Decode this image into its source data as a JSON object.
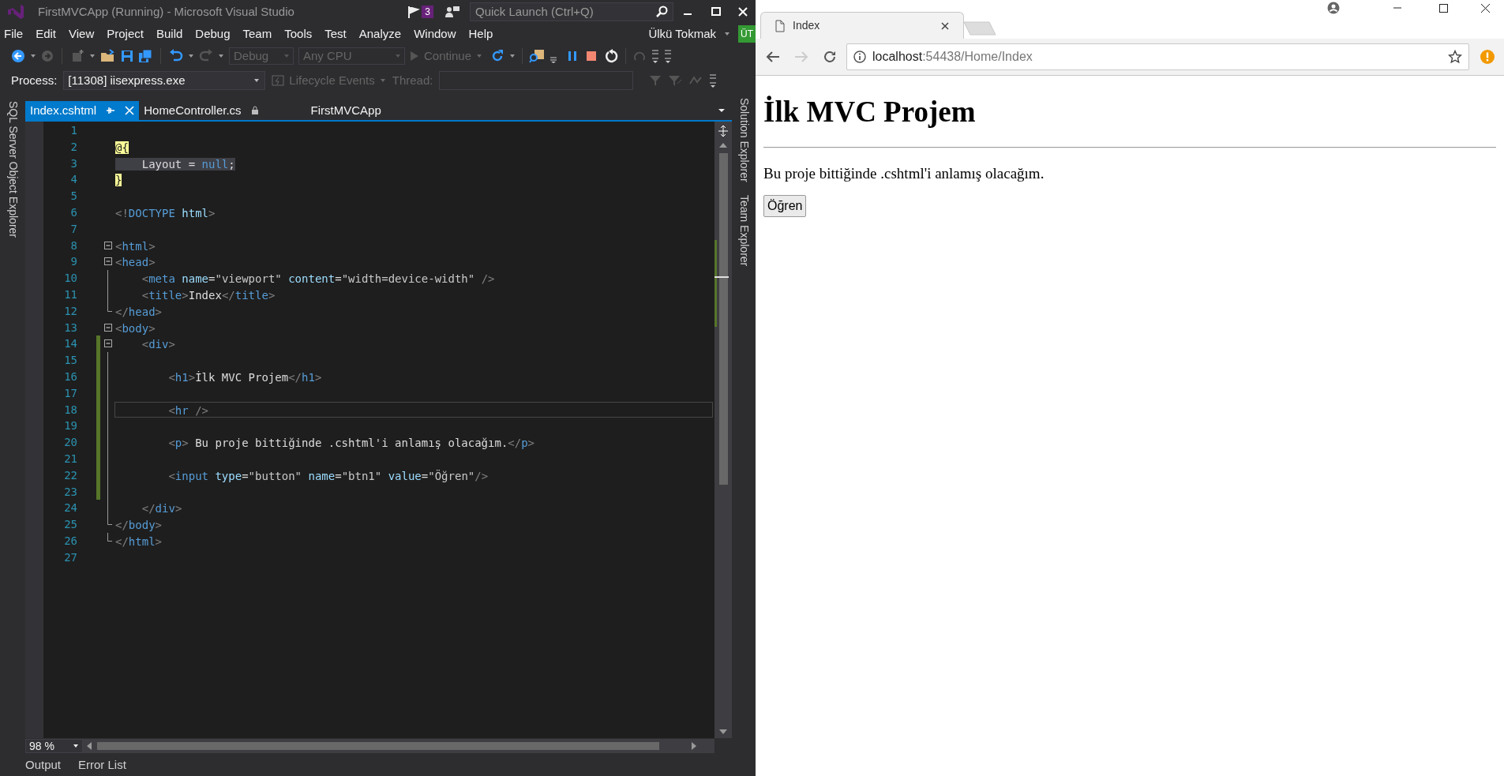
{
  "vs": {
    "title": "FirstMVCApp (Running) - Microsoft Visual Studio",
    "notification_count": "3",
    "quick_launch": {
      "placeholder": "Quick Launch (Ctrl+Q)"
    },
    "menu": [
      "File",
      "Edit",
      "View",
      "Project",
      "Build",
      "Debug",
      "Team",
      "Tools",
      "Test",
      "Analyze",
      "Window",
      "Help"
    ],
    "user": {
      "name": "Ülkü Tokmak",
      "initials": "ÜT"
    },
    "toolbar": {
      "configuration": {
        "label": "Debug",
        "disabled": true
      },
      "platform": {
        "label": "Any CPU",
        "disabled": true
      },
      "continue": {
        "label": "Continue",
        "disabled": true
      }
    },
    "debug_location": {
      "process_label": "Process:",
      "process": "[11308] iisexpress.exe",
      "lifecycle": {
        "label": "Lifecycle Events",
        "disabled": true
      },
      "thread_label": "Thread:"
    },
    "left_panel": [
      "SQL Server Object Explorer"
    ],
    "right_panel": [
      "Solution Explorer",
      "Team Explorer"
    ],
    "tabs": [
      {
        "label": "Index.cshtml",
        "selected": true
      },
      {
        "label": "HomeController.cs",
        "selected": false
      }
    ],
    "project_label": "FirstMVCApp",
    "editor": {
      "lines": [
        {
          "number": "1",
          "kind": "plain"
        },
        {
          "number": "2",
          "kind": "plain",
          "tokens": [
            {
              "kind": "razor",
              "text": "@{"
            }
          ]
        },
        {
          "number": "3",
          "kind": "plain",
          "tokens": [
            {
              "kind": "text",
              "text": "    Layout = ",
              "highlighted": true
            },
            {
              "kind": "keyword",
              "text": "null",
              "highlighted": true
            },
            {
              "kind": "text",
              "text": ";",
              "highlighted": true
            }
          ]
        },
        {
          "number": "4",
          "kind": "plain",
          "tokens": [
            {
              "kind": "razor",
              "text": "}"
            }
          ]
        },
        {
          "number": "5",
          "kind": "plain"
        },
        {
          "number": "6",
          "kind": "plain",
          "tokens": [
            {
              "kind": "delim",
              "text": "<!"
            },
            {
              "kind": "tag",
              "text": "DOCTYPE"
            },
            {
              "kind": "attr",
              "text": " html"
            },
            {
              "kind": "delim",
              "text": ">"
            }
          ]
        },
        {
          "number": "7",
          "kind": "plain"
        },
        {
          "number": "8",
          "kind": "start",
          "tokens": [
            {
              "kind": "delim",
              "text": "<"
            },
            {
              "kind": "tag",
              "text": "html"
            },
            {
              "kind": "delim",
              "text": ">"
            }
          ]
        },
        {
          "number": "9",
          "kind": "start",
          "tokens": [
            {
              "kind": "delim",
              "text": "<"
            },
            {
              "kind": "tag",
              "text": "head"
            },
            {
              "kind": "delim",
              "text": ">"
            }
          ]
        },
        {
          "number": "10",
          "kind": "body",
          "tokens": [
            {
              "kind": "delim",
              "text": "    <"
            },
            {
              "kind": "tag",
              "text": "meta"
            },
            {
              "kind": "attr",
              "text": " name"
            },
            {
              "kind": "text",
              "text": "="
            },
            {
              "kind": "value",
              "text": "\"viewport\""
            },
            {
              "kind": "attr",
              "text": " content"
            },
            {
              "kind": "text",
              "text": "="
            },
            {
              "kind": "value",
              "text": "\"width=device-width\""
            },
            {
              "kind": "delim",
              "text": " />"
            }
          ]
        },
        {
          "number": "11",
          "kind": "body",
          "tokens": [
            {
              "kind": "delim",
              "text": "    <"
            },
            {
              "kind": "tag",
              "text": "title"
            },
            {
              "kind": "delim",
              "text": ">"
            },
            {
              "kind": "text",
              "text": "Index"
            },
            {
              "kind": "delim",
              "text": "</"
            },
            {
              "kind": "tag",
              "text": "title"
            },
            {
              "kind": "delim",
              "text": ">"
            }
          ]
        },
        {
          "number": "12",
          "kind": "end",
          "tokens": [
            {
              "kind": "delim",
              "text": "</"
            },
            {
              "kind": "tag",
              "text": "head"
            },
            {
              "kind": "delim",
              "text": ">"
            }
          ]
        },
        {
          "number": "13",
          "kind": "start",
          "tokens": [
            {
              "kind": "delim",
              "text": "<"
            },
            {
              "kind": "tag",
              "text": "body"
            },
            {
              "kind": "delim",
              "text": ">"
            }
          ]
        },
        {
          "number": "14",
          "kind": "start",
          "changed": true,
          "tokens": [
            {
              "kind": "delim",
              "text": "    <"
            },
            {
              "kind": "tag",
              "text": "div"
            },
            {
              "kind": "delim",
              "text": ">"
            }
          ]
        },
        {
          "number": "15",
          "kind": "body",
          "changed": true
        },
        {
          "number": "16",
          "kind": "body",
          "changed": true,
          "tokens": [
            {
              "kind": "delim",
              "text": "        <"
            },
            {
              "kind": "tag",
              "text": "h1"
            },
            {
              "kind": "delim",
              "text": ">"
            },
            {
              "kind": "text",
              "text": "İlk MVC Projem"
            },
            {
              "kind": "delim",
              "text": "</"
            },
            {
              "kind": "tag",
              "text": "h1"
            },
            {
              "kind": "delim",
              "text": ">"
            }
          ]
        },
        {
          "number": "17",
          "kind": "body",
          "changed": true
        },
        {
          "number": "18",
          "kind": "body",
          "changed": true,
          "current": true,
          "tokens": [
            {
              "kind": "delim",
              "text": "        <"
            },
            {
              "kind": "tag",
              "text": "hr"
            },
            {
              "kind": "delim",
              "text": " />"
            }
          ]
        },
        {
          "number": "19",
          "kind": "body",
          "changed": true
        },
        {
          "number": "20",
          "kind": "body",
          "changed": true,
          "tokens": [
            {
              "kind": "delim",
              "text": "        <"
            },
            {
              "kind": "tag",
              "text": "p"
            },
            {
              "kind": "delim",
              "text": ">"
            },
            {
              "kind": "text",
              "text": " Bu proje bittiğinde .cshtml'i anlamış olacağım."
            },
            {
              "kind": "delim",
              "text": "</"
            },
            {
              "kind": "tag",
              "text": "p"
            },
            {
              "kind": "delim",
              "text": ">"
            }
          ]
        },
        {
          "number": "21",
          "kind": "body",
          "changed": true
        },
        {
          "number": "22",
          "kind": "body",
          "changed": true,
          "tokens": [
            {
              "kind": "delim",
              "text": "        <"
            },
            {
              "kind": "tag",
              "text": "input"
            },
            {
              "kind": "attr",
              "text": " type"
            },
            {
              "kind": "text",
              "text": "="
            },
            {
              "kind": "value",
              "text": "\"button\""
            },
            {
              "kind": "attr",
              "text": " name"
            },
            {
              "kind": "text",
              "text": "="
            },
            {
              "kind": "value",
              "text": "\"btn1\""
            },
            {
              "kind": "attr",
              "text": " value"
            },
            {
              "kind": "text",
              "text": "="
            },
            {
              "kind": "value",
              "text": "\"Öğren\""
            },
            {
              "kind": "delim",
              "text": "/>"
            }
          ]
        },
        {
          "number": "23",
          "kind": "body",
          "changed": true
        },
        {
          "number": "24",
          "kind": "body",
          "tokens": [
            {
              "kind": "delim",
              "text": "    </"
            },
            {
              "kind": "tag",
              "text": "div"
            },
            {
              "kind": "delim",
              "text": ">"
            }
          ]
        },
        {
          "number": "25",
          "kind": "end",
          "tokens": [
            {
              "kind": "delim",
              "text": "</"
            },
            {
              "kind": "tag",
              "text": "body"
            },
            {
              "kind": "delim",
              "text": ">"
            }
          ]
        },
        {
          "number": "26",
          "kind": "end",
          "tokens": [
            {
              "kind": "delim",
              "text": "</"
            },
            {
              "kind": "tag",
              "text": "html"
            },
            {
              "kind": "delim",
              "text": ">"
            }
          ]
        },
        {
          "number": "27",
          "kind": "plain"
        }
      ]
    },
    "zoom": "98 %",
    "bottom_tabs": [
      "Output",
      "Error List"
    ]
  },
  "browser": {
    "tab": {
      "title": "Index"
    },
    "url": {
      "host": "localhost",
      "path": ":54438/Home/Index"
    },
    "page": {
      "heading": "İlk MVC Projem",
      "paragraph": "Bu proje bittiğinde .cshtml'i anlamış olacağım.",
      "button": "Öğren"
    }
  }
}
